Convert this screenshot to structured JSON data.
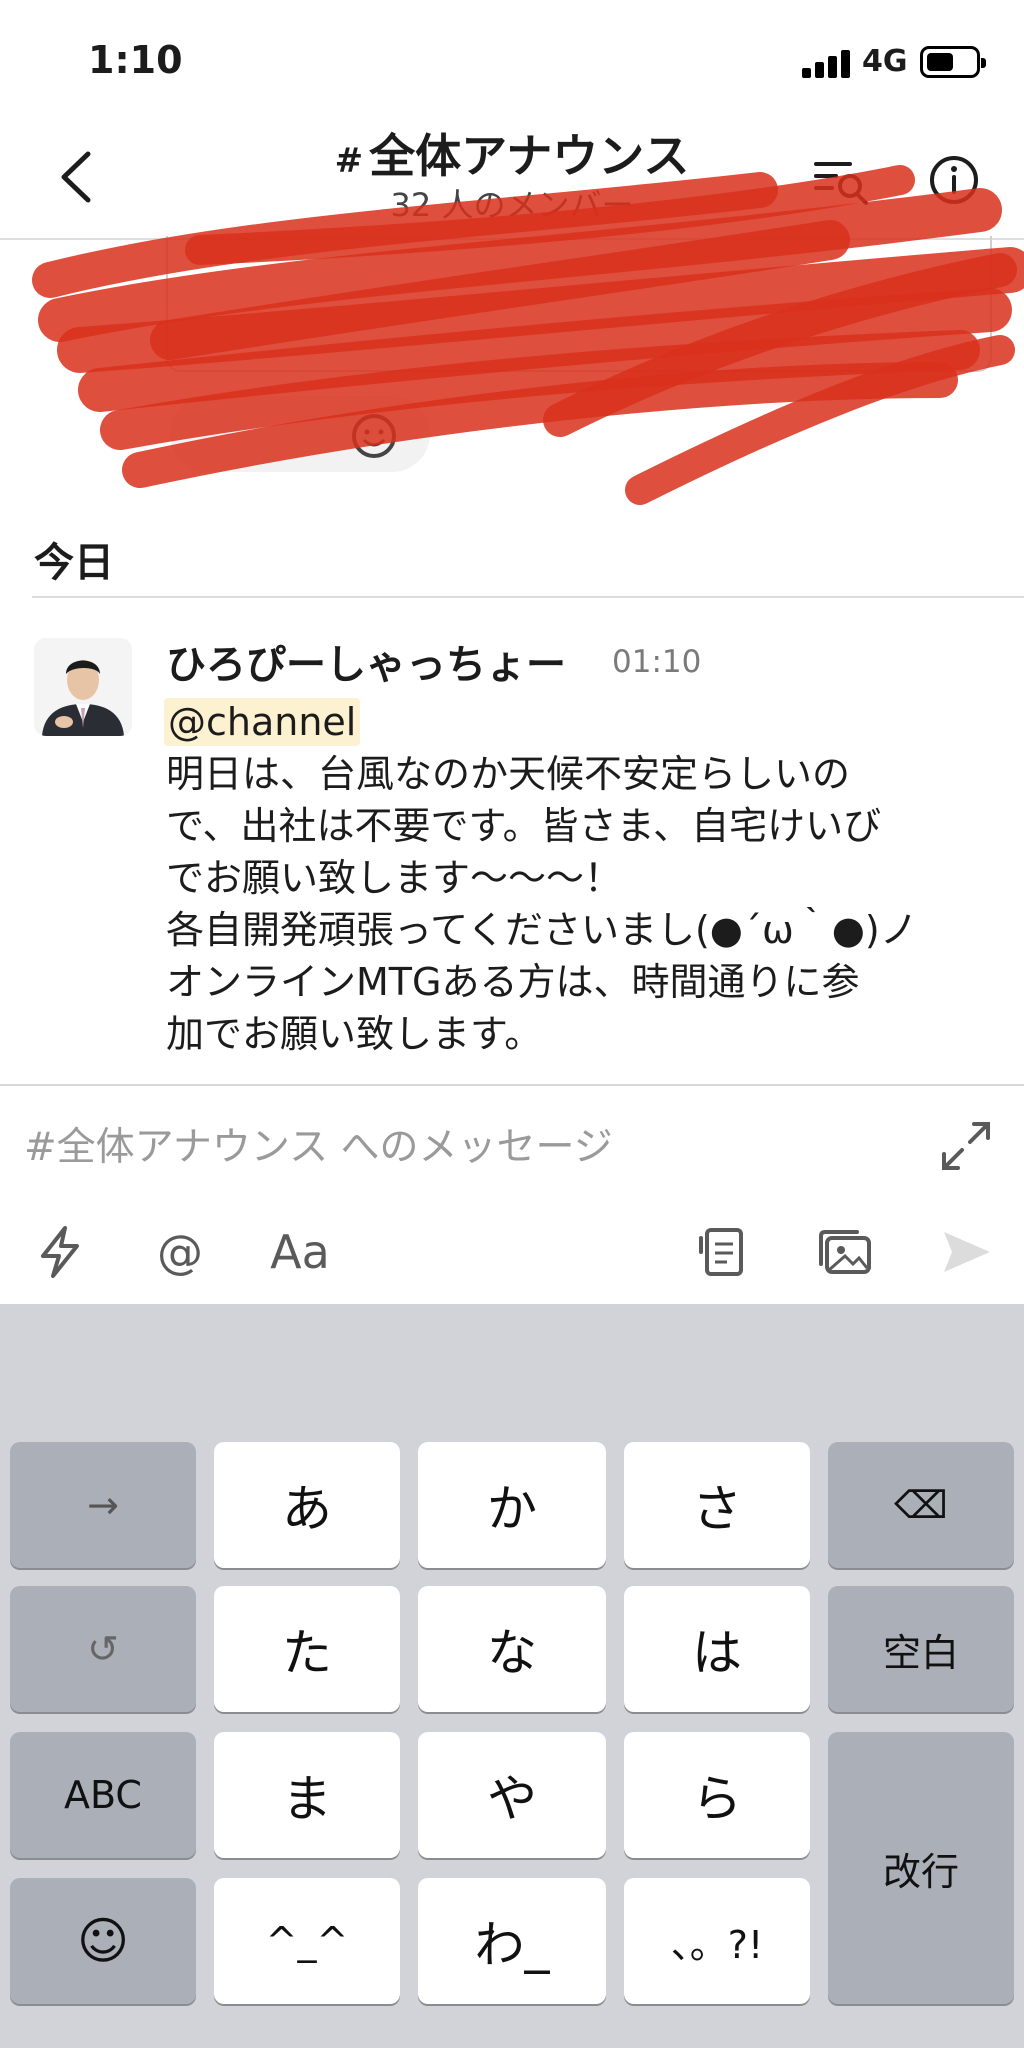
{
  "status_bar": {
    "time": "1:10",
    "network": "4G"
  },
  "header": {
    "hash": "#",
    "channel_name": "全体アナウンス",
    "member_count": "32 人のメンバー"
  },
  "messages": {
    "day_label": "今日",
    "items": [
      {
        "author": "ひろぴーしゃっちょー",
        "time": "01:10",
        "mention": "@channel",
        "body": "明日は、台風なのか天候不安定らしいの\nで、出社は不要です。皆さま、自宅けいび\nでお願い致します〜〜〜！\n各自開発頑張ってくださいまし(●´ω｀●)ノ\nオンラインMTGある方は、時間通りに参\n加でお願い致します。"
      }
    ]
  },
  "composer": {
    "placeholder": "#全体アナウンス へのメッセージ",
    "value": "",
    "format_label": "Aa",
    "mention_label": "@"
  },
  "keyboard": {
    "rows": [
      [
        "→",
        "あ",
        "か",
        "さ",
        "⌫"
      ],
      [
        "↺",
        "た",
        "な",
        "は",
        "空白"
      ],
      [
        "ABC",
        "ま",
        "や",
        "ら",
        "改行"
      ],
      [
        "☺",
        "^_^",
        "わ_",
        "、。?!"
      ]
    ]
  },
  "colors": {
    "mention_highlight": "#fcf1d0",
    "redaction_red": "#d9301c",
    "keyboard_bg": "#d1d3d9",
    "func_key": "#abafb8"
  }
}
